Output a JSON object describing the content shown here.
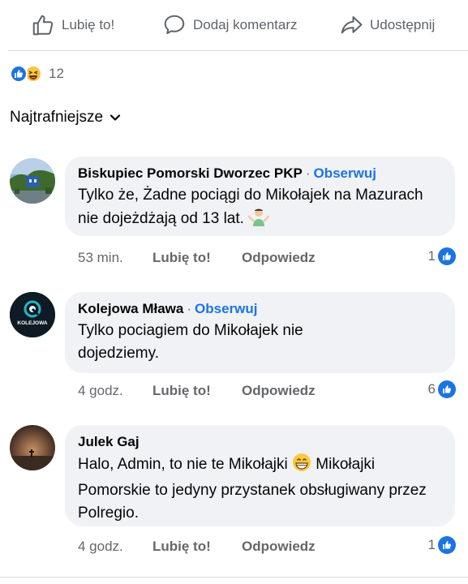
{
  "actions": {
    "like": "Lubię to!",
    "comment": "Dodaj komentarz",
    "share": "Udostępnij"
  },
  "reactions": {
    "count": "12",
    "types": [
      "like-icon",
      "haha-icon"
    ],
    "like_color": "#1b74e4"
  },
  "sort": {
    "label": "Najtrafniejsze"
  },
  "comments": [
    {
      "author": "Biskupiec Pomorski Dworzec PKP",
      "follow": "Obserwuj",
      "text": "Tylko że, Żadne pociągi do Mikołajek na Mazurach nie dojeżdżają od 13 lat.",
      "emoji": "shrug-emoji",
      "time": "53 min.",
      "like": "Lubię to!",
      "reply": "Odpowiedz",
      "likes": "1"
    },
    {
      "author": "Kolejowa Mława",
      "follow": "Obserwuj",
      "text": "Tylko pociagiem do Mikołajek nie dojedziemy.",
      "avatar_text": "KOLEJOWA",
      "time": "4 godz.",
      "like": "Lubię to!",
      "reply": "Odpowiedz",
      "likes": "6"
    },
    {
      "author": "Julek Gaj",
      "text_before": "Halo, Admin, to nie te Mikołajki",
      "emoji": "grin-emoji",
      "text_after": "Mikołajki Pomorskie to jedyny przystanek obsługiwany przez Polregio.",
      "time": "4 godz.",
      "like": "Lubię to!",
      "reply": "Odpowiedz",
      "likes": "1"
    }
  ]
}
